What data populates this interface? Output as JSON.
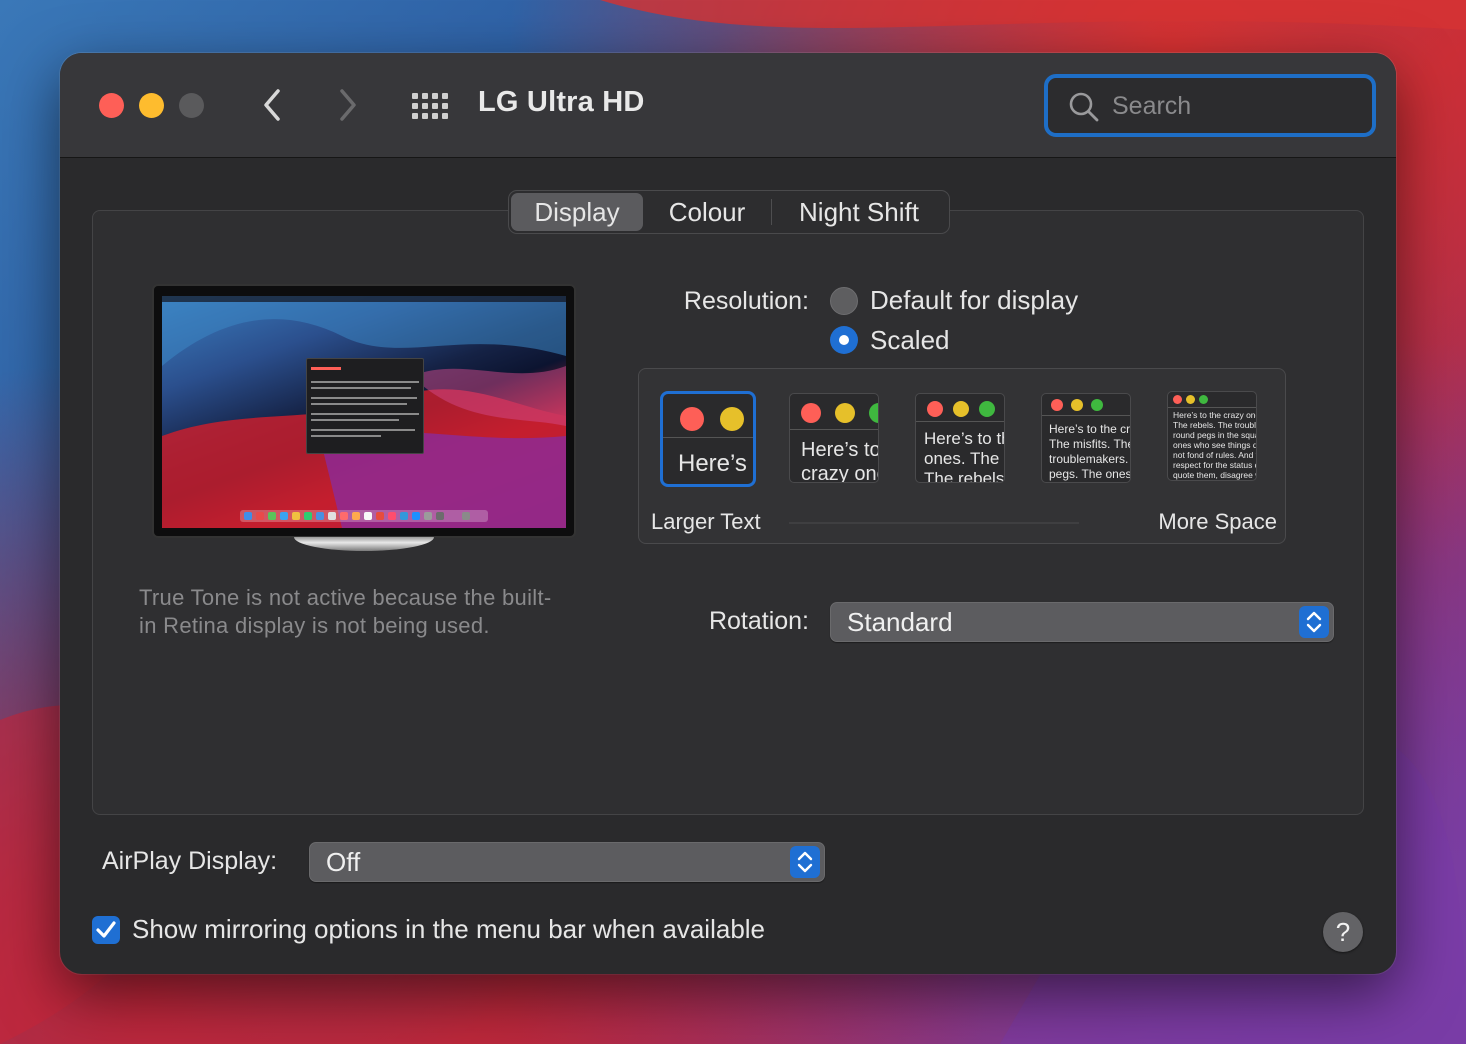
{
  "window": {
    "title": "LG Ultra HD",
    "search_placeholder": "Search"
  },
  "tabs": [
    {
      "label": "Display",
      "active": true
    },
    {
      "label": "Colour",
      "active": false
    },
    {
      "label": "Night Shift",
      "active": false
    }
  ],
  "true_tone_note": "True Tone is not active because the built-in Retina display is not being used.",
  "true_tone_line1": "True Tone is not active because the built-",
  "true_tone_line2": "in Retina display is not being used.",
  "resolution": {
    "label": "Resolution:",
    "options": [
      {
        "label": "Default for display",
        "selected": false
      },
      {
        "label": "Scaled",
        "selected": true
      }
    ],
    "scale_min_label": "Larger Text",
    "scale_max_label": "More Space",
    "previews": [
      {
        "text": "Here’s",
        "selected": true
      },
      {
        "text": "Here’s to the crazy ones. The misfits. The rebels. The troublemakers.",
        "selected": false
      },
      {
        "text": "Here’s to the crazy ones. The misfits. The rebels. The troublemakers. The round pegs. The ones who see things differently.",
        "selected": false
      },
      {
        "text": "Here’s to the crazy ones. The misfits. The rebels. The troublemakers. The round pegs. The ones who see things differently. They’re not fond of rules. And they have no respect for the status quo.",
        "selected": false
      },
      {
        "text": "Here’s to the crazy ones. The misfits. The rebels. The troublemakers. The round pegs in the square holes. The ones who see things differently. They’re not fond of rules. And they have no respect for the status quo. You can quote them, disagree with them, glorify or vilify them. About the only thing you can’t do is ignore them. Because they change things.",
        "selected": false
      }
    ]
  },
  "rotation": {
    "label": "Rotation:",
    "value": "Standard"
  },
  "airplay": {
    "label": "AirPlay Display:",
    "value": "Off"
  },
  "mirroring": {
    "label": "Show mirroring options in the menu bar when available",
    "checked": true
  },
  "help_label": "?",
  "colors": {
    "accent": "#1f6fd3",
    "close": "#fe5f57",
    "minimize": "#febc2e",
    "zoom_disabled": "#5a5a5c"
  }
}
